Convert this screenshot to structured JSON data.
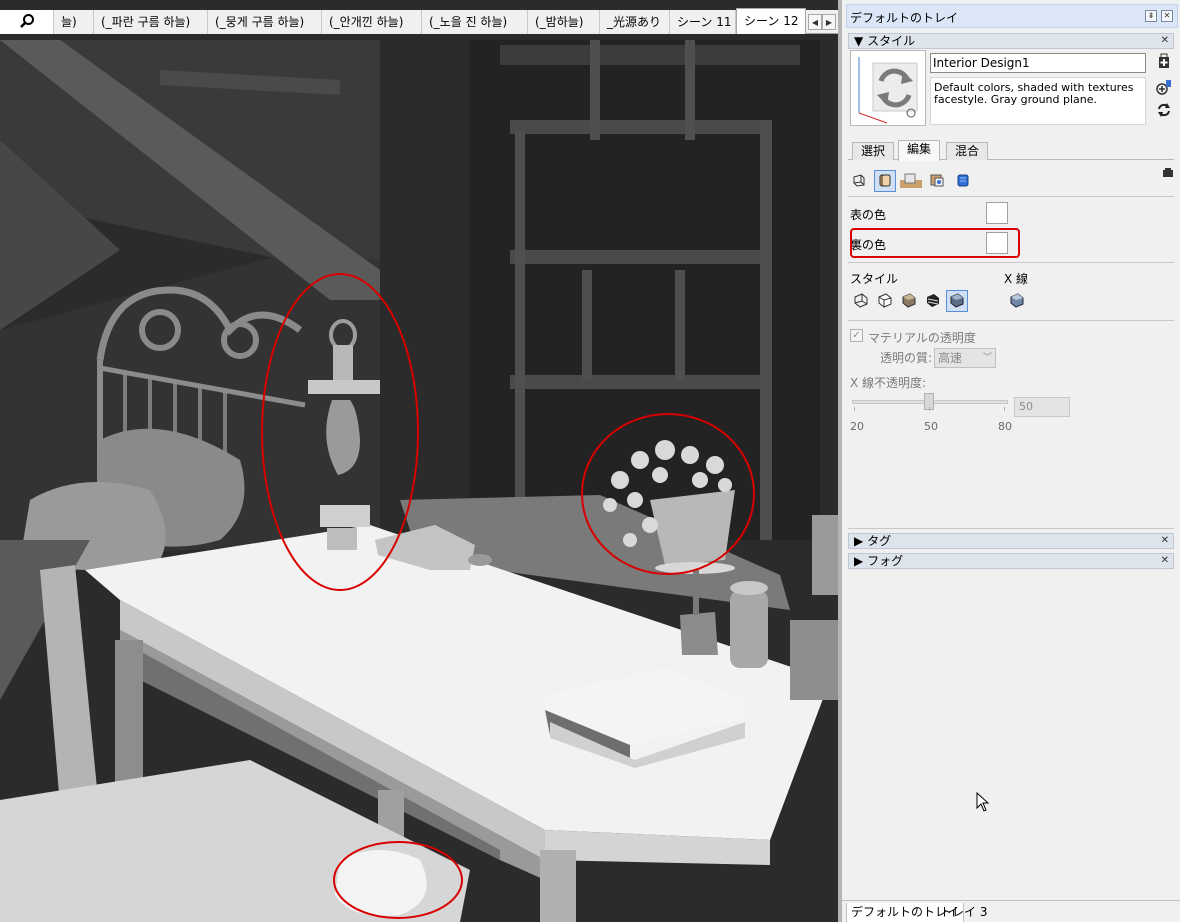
{
  "scene_tabs": {
    "items": [
      {
        "label": "늘)"
      },
      {
        "label": "(_파란 구름 하늘)"
      },
      {
        "label": "(_뭉게 구름 하늘)"
      },
      {
        "label": "(_안개낀 하늘)"
      },
      {
        "label": "(_노을 진 하늘)"
      },
      {
        "label": "(_밤하늘)"
      },
      {
        "label": "_光源あり"
      },
      {
        "label": "シーン 11"
      },
      {
        "label": "シーン 12"
      }
    ],
    "active_index": 8
  },
  "tray": {
    "title": "デフォルトのトレイ",
    "style_section": {
      "title": "スタイル",
      "style_name": "Interior Design1",
      "description": "Default colors, shaded with textures facestyle. Gray ground plane.",
      "subtabs": [
        "選択",
        "編集",
        "混合"
      ],
      "active_subtab": "編集",
      "front_color_label": "表の色",
      "back_color_label": "裏の色",
      "front_color": "#ffffff",
      "back_color": "#ffffff",
      "style_label": "スタイル",
      "xray_label": "X 線",
      "transparency_label": "マテリアルの透明度",
      "transparency_checked": true,
      "quality_label": "透明の質:",
      "quality_value": "高速",
      "xray_opacity_label": "X 線不透明度:",
      "slider_ticks": [
        "20",
        "50",
        "80"
      ],
      "xray_opacity_value": "50",
      "xray_opacity": 50
    },
    "collapsed_sections": [
      {
        "title": "タグ"
      },
      {
        "title": "フォグ"
      }
    ],
    "footer_tabs": [
      "デフォルトのトレイ",
      "トレイ 3"
    ],
    "active_footer_tab": "デフォルトのトレイ"
  },
  "colors": {
    "highlight": "#d80000",
    "selected_icon_border": "#5d8fd6",
    "tray_titlebar": "#dbe7f6"
  }
}
